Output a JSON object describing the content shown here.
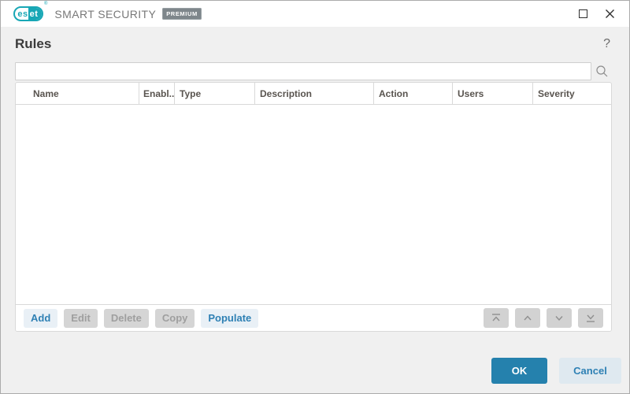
{
  "titlebar": {
    "logo": {
      "left": "es",
      "right": "et",
      "registered_mark": "®"
    },
    "product_name": "SMART SECURITY",
    "edition_badge": "PREMIUM",
    "controls": {
      "maximize_icon": "maximize-square",
      "close_icon": "close-x"
    }
  },
  "page": {
    "title": "Rules",
    "help_glyph": "?"
  },
  "search": {
    "value": "",
    "placeholder": "",
    "icon": "magnifier"
  },
  "table": {
    "columns": [
      "Name",
      "Enabl...",
      "Type",
      "Description",
      "Action",
      "Users",
      "Severity"
    ],
    "rows": []
  },
  "actions": {
    "add": "Add",
    "edit": "Edit",
    "delete": "Delete",
    "copy": "Copy",
    "populate": "Populate",
    "disabled_buttons": [
      "Edit",
      "Delete",
      "Copy"
    ]
  },
  "reorder_icons": [
    "move-to-top",
    "move-up",
    "move-down",
    "move-to-bottom"
  ],
  "footer": {
    "ok": "OK",
    "cancel": "Cancel"
  },
  "colors": {
    "brand_teal": "#18a7b5",
    "accent_blue": "#2581ad",
    "link_blue": "#2e80b4",
    "light_button_bg": "#e9f0f6",
    "disabled_bg": "#d5d5d5",
    "page_bg": "#f0f0f0",
    "panel_border": "#d9d9d9"
  }
}
